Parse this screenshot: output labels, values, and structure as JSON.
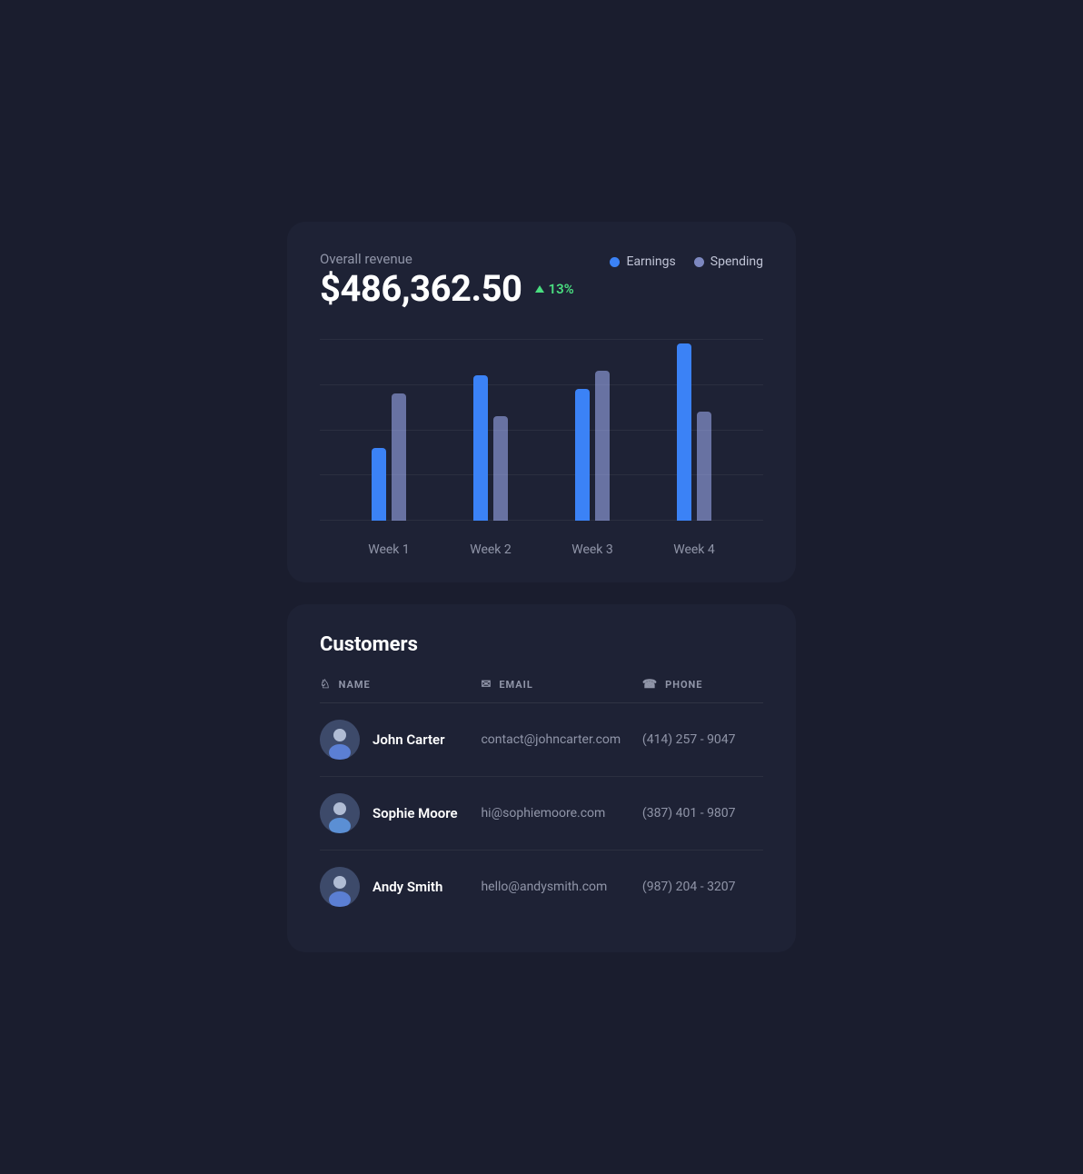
{
  "revenue": {
    "title": "Overall revenue",
    "amount": "$486,362.50",
    "change": "13%",
    "legend": {
      "earnings_label": "Earnings",
      "spending_label": "Spending"
    },
    "chart": {
      "weeks": [
        "Week 1",
        "Week 2",
        "Week 3",
        "Week 4"
      ],
      "bars": [
        {
          "earnings_height": 80,
          "spending_height": 140
        },
        {
          "earnings_height": 160,
          "spending_height": 115
        },
        {
          "earnings_height": 145,
          "spending_height": 165
        },
        {
          "earnings_height": 195,
          "spending_height": 120
        }
      ]
    }
  },
  "customers": {
    "title": "Customers",
    "columns": {
      "name": "NAME",
      "email": "EMAIL",
      "phone": "PHONE"
    },
    "rows": [
      {
        "name": "John Carter",
        "email": "contact@johncarter.com",
        "phone": "(414) 257 - 9047",
        "avatar_color": "#4a5580"
      },
      {
        "name": "Sophie Moore",
        "email": "hi@sophiemoore.com",
        "phone": "(387) 401 - 9807",
        "avatar_color": "#3d4870"
      },
      {
        "name": "Andy Smith",
        "email": "hello@andysmith.com",
        "phone": "(987) 204 - 3207",
        "avatar_color": "#4a5580"
      }
    ]
  }
}
